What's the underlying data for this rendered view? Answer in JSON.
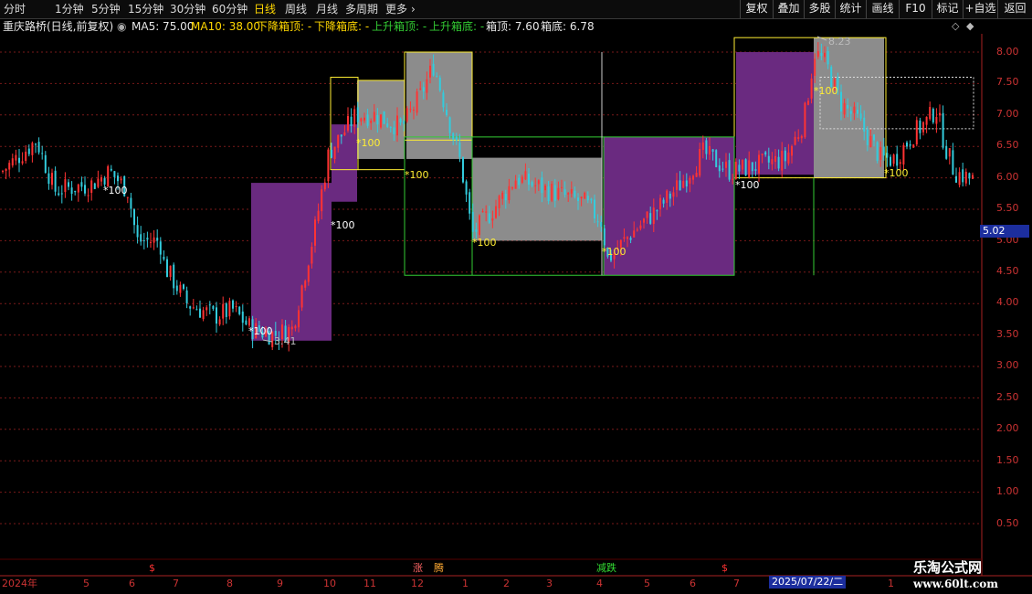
{
  "toolbar": {
    "periods": [
      "分时",
      "1分钟",
      "5分钟",
      "15分钟",
      "30分钟",
      "60分钟",
      "日线",
      "周线",
      "月线",
      "多周期",
      "更多"
    ],
    "active_period": "日线",
    "right_buttons": [
      "复权",
      "叠加",
      "多股",
      "统计",
      "画线",
      "F10",
      "标记",
      "+自选",
      "返回"
    ]
  },
  "indicator": {
    "stock_title": "重庆路桥(日线,前复权)",
    "items": [
      {
        "text": "MA5: 75.00",
        "color": "#e8e8e8"
      },
      {
        "text": "MA10: 38.00",
        "color": "#ffd700"
      },
      {
        "text": "下降箱顶: -",
        "color": "#ffd700"
      },
      {
        "text": "下降箱底: -",
        "color": "#ffd700"
      },
      {
        "text": "上升箱顶: -",
        "color": "#33cc33"
      },
      {
        "text": "上升箱底: -",
        "color": "#33cc33"
      },
      {
        "text": "箱顶: 7.60",
        "color": "#e8e8e8"
      },
      {
        "text": "箱底: 6.78",
        "color": "#e8e8e8"
      }
    ]
  },
  "y_axis": {
    "ticks": [
      "8.00",
      "7.50",
      "7.00",
      "6.50",
      "6.00",
      "5.50",
      "5.00",
      "4.50",
      "4.00",
      "3.50",
      "3.00",
      "2.50",
      "2.00",
      "1.50",
      "1.00",
      "0.50"
    ],
    "current_price": "5.02"
  },
  "x_axis": {
    "labels": [
      "2024年",
      "5",
      "6",
      "7",
      "8",
      "9",
      "10",
      "11",
      "12",
      "1",
      "2",
      "3",
      "4",
      "5",
      "6",
      "7",
      "1"
    ],
    "cursor_date": "2025/07/22/二"
  },
  "events": [
    {
      "text": "$",
      "color": "#ff3333"
    },
    {
      "text": "涨",
      "color": "#ff6666"
    },
    {
      "text": "腾",
      "color": "#ffaa33"
    },
    {
      "text": "减跌",
      "color": "#33dd33"
    },
    {
      "text": "$",
      "color": "#ff3333"
    }
  ],
  "annotations": {
    "high_price": "8.23",
    "low_price": "3.41",
    "markers": [
      "*100",
      "*100",
      "*100",
      "*100",
      "*100",
      "*100",
      "*100",
      "*100",
      "*100",
      "*100"
    ]
  },
  "colors": {
    "up": "#ff3333",
    "down": "#33ccdd",
    "purple_box": "#6a2a80",
    "gray_box": "#8c8c8c",
    "yellow_line": "#ffee33",
    "green_line": "#33cc33",
    "grid": "#7a1a1a"
  },
  "watermark": {
    "line1": "乐淘公式网",
    "line2": "www.60lt.com"
  }
}
